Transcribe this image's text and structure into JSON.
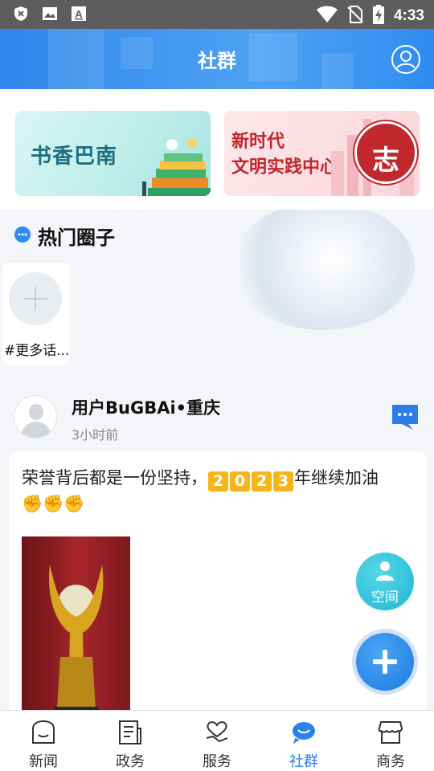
{
  "status_bar": {
    "time": "4:33",
    "left_icons": [
      "shield-x-icon",
      "image-icon",
      "font-a-icon"
    ],
    "right_icons": [
      "wifi-icon",
      "no-sim-icon",
      "battery-charging-icon"
    ]
  },
  "header": {
    "title": "社群",
    "profile_icon": "user-circle-icon",
    "bg_color": "#3a90ee"
  },
  "banners": [
    {
      "text": "书香巴南"
    },
    {
      "line1": "新时代",
      "line2": "文明实践中心",
      "seal_char": "志"
    }
  ],
  "hot_circles": {
    "title": "热门圈子",
    "more_label": "#更多话..."
  },
  "post": {
    "username": "用户BuGBAi•重庆",
    "time": "3小时前",
    "text_before": "荣誉背后都是一份坚持，",
    "year_digits": [
      "2",
      "0",
      "2",
      "3"
    ],
    "text_after": "年继续加油",
    "emojis": [
      "✊",
      "✊",
      "✊"
    ]
  },
  "fab": {
    "space_label": "空间"
  },
  "bottom_nav": [
    {
      "label": "新闻",
      "icon": "news-icon",
      "active": false
    },
    {
      "label": "政务",
      "icon": "government-icon",
      "active": false
    },
    {
      "label": "服务",
      "icon": "service-heart-icon",
      "active": false
    },
    {
      "label": "社群",
      "icon": "community-icon",
      "active": true
    },
    {
      "label": "商务",
      "icon": "shop-icon",
      "active": false
    }
  ],
  "colors": {
    "accent": "#2a82ea",
    "badge": "#f7b51a"
  }
}
